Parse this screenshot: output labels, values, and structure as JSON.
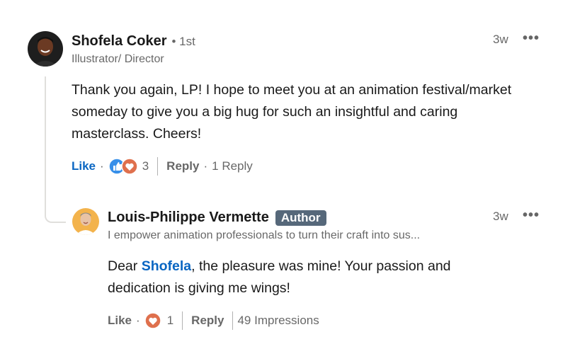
{
  "comment": {
    "author_name": "Shofela Coker",
    "degree": "• 1st",
    "headline": "Illustrator/ Director",
    "time": "3w",
    "body": "Thank you again, LP! I hope to meet you at an animation festival/market someday to give you a big hug for such an insightful and caring masterclass. Cheers!",
    "like_label": "Like",
    "dot": "·",
    "reaction_count": "3",
    "reply_label": "Reply",
    "replies_count": "1 Reply",
    "reaction_icons": [
      "like-icon",
      "love-icon"
    ]
  },
  "reply": {
    "author_name": "Louis-Philippe Vermette",
    "badge": "Author",
    "headline": "I empower animation professionals to turn their craft into sus...",
    "time": "3w",
    "body_prefix": "Dear ",
    "mention": "Shofela",
    "body_suffix": ", the pleasure was mine! Your passion and dedication is giving me wings!",
    "like_label": "Like",
    "dot": "·",
    "reaction_count": "1",
    "reply_label": "Reply",
    "impressions": "49 Impressions",
    "reaction_icons": [
      "love-icon"
    ]
  },
  "icons": {
    "more": "more-options-icon"
  },
  "colors": {
    "link_blue": "#0a66c2",
    "badge_bg": "#56687a",
    "love_red": "#df704d"
  }
}
